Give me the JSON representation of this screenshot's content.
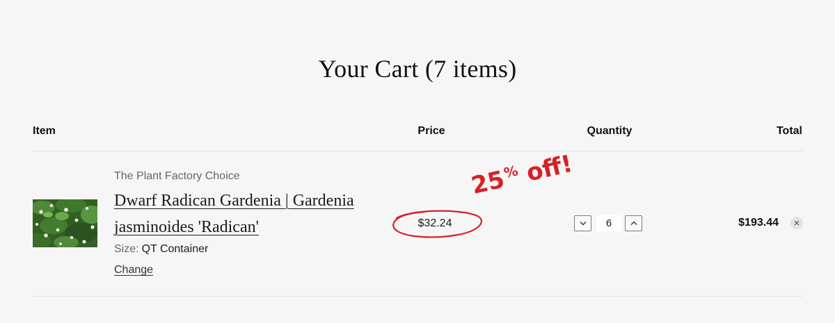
{
  "cart": {
    "title": "Your Cart (7 items)",
    "columns": {
      "item": "Item",
      "price": "Price",
      "quantity": "Quantity",
      "total": "Total"
    },
    "line_items": [
      {
        "vendor": "The Plant Factory Choice",
        "title": "Dwarf Radican Gardenia | Gardenia jasminoides 'Radican'",
        "variant_label": "Size:",
        "variant_value": "QT Container",
        "change_label": "Change",
        "price": "$32.24",
        "quantity": "6",
        "total": "$193.44",
        "icons": {
          "decrease": "chevron-down-icon",
          "increase": "chevron-up-icon",
          "remove": "close-icon"
        }
      }
    ]
  },
  "annotation": {
    "number": "25",
    "percent_sign": "%",
    "text": " off!",
    "color": "#d81f26"
  }
}
